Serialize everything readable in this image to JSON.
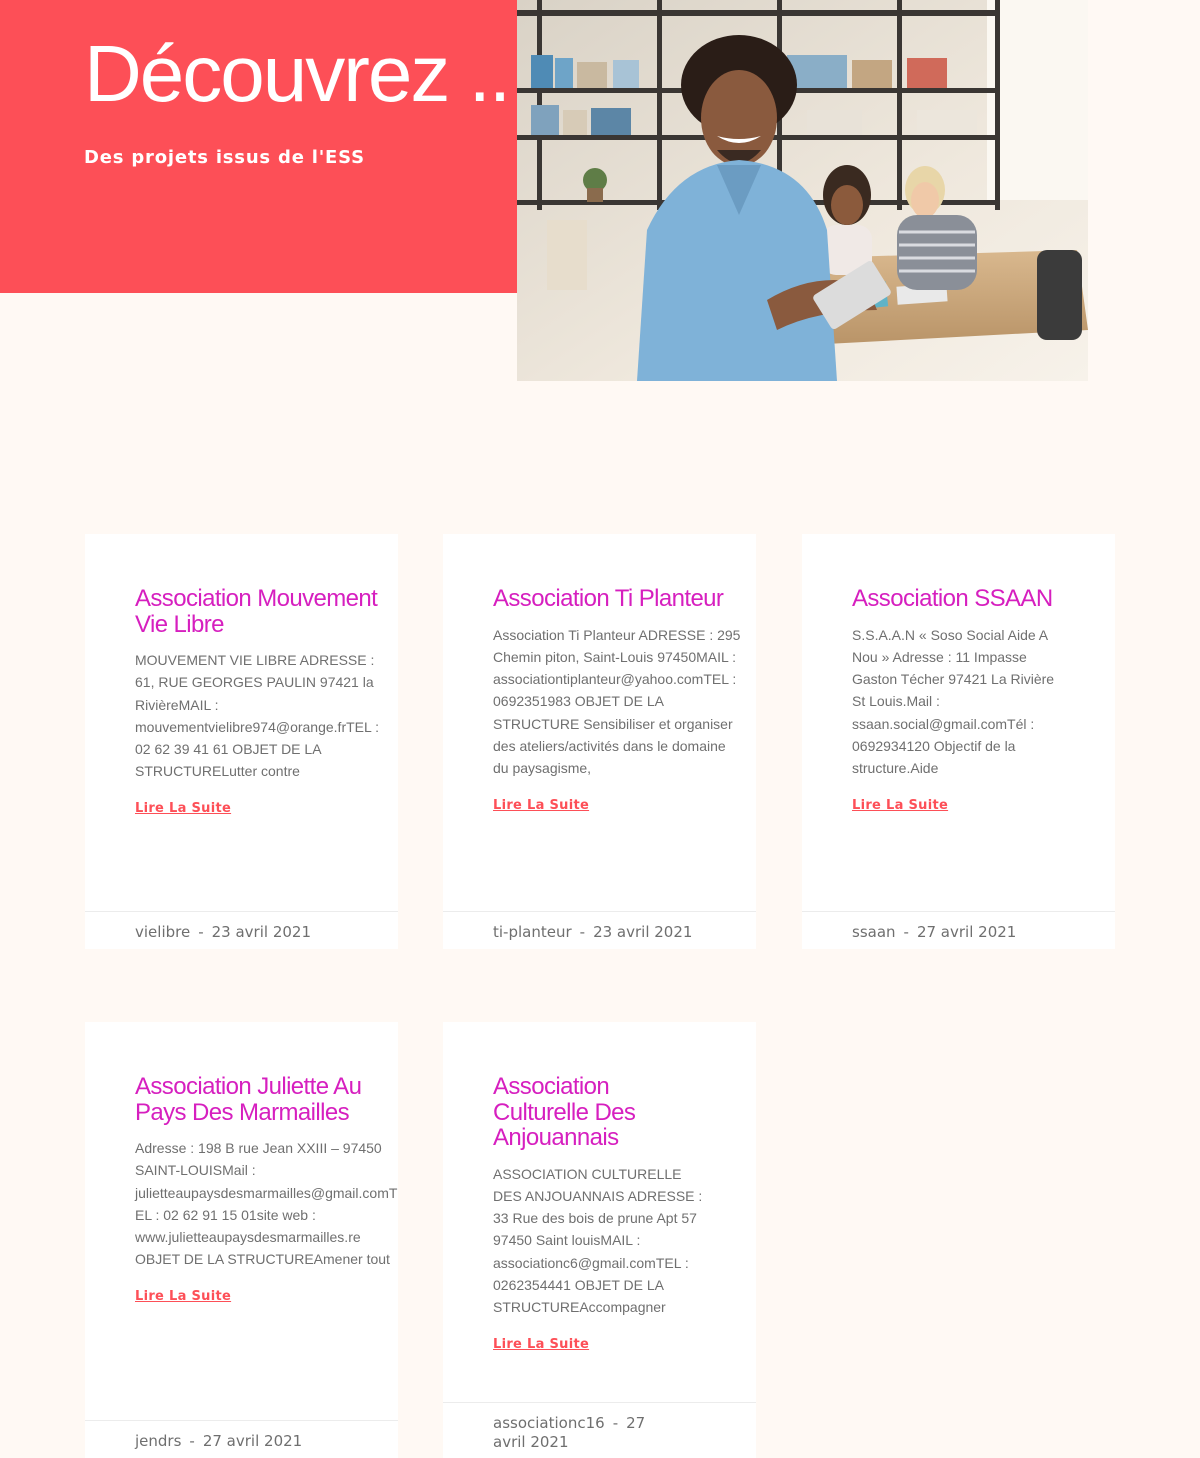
{
  "hero": {
    "title": "Découvrez ..",
    "subtitle": "Des projets issus de l'ESS"
  },
  "colors": {
    "accent": "#fd4f57",
    "title": "#d61fbf",
    "background": "#fff9f4"
  },
  "posts": [
    {
      "title": "Association Mouvement Vie Libre",
      "excerpt": "MOUVEMENT VIE LIBRE ADRESSE : 61, RUE GEORGES PAULIN 97421 la RivièreMAIL : mouvementvielibre974@orange.frTEL : 02 62 39 41 61 OBJET DE LA STRUCTURELutter contre",
      "more": "Lire La Suite",
      "author": "vielibre",
      "sep": "-",
      "date": "23 avril 2021"
    },
    {
      "title": "Association Ti Planteur",
      "excerpt": "Association Ti Planteur ADRESSE : 295 Chemin piton, Saint-Louis 97450MAIL : associationtiplanteur@yahoo.comTEL : 0692351983 OBJET DE LA STRUCTURE Sensibiliser et organiser des ateliers/activités dans le domaine du paysagisme,",
      "more": "Lire La Suite",
      "author": "ti-planteur",
      "sep": "-",
      "date": "23 avril 2021"
    },
    {
      "title": "Association SSAAN",
      "excerpt": "S.S.A.A.N « Soso Social Aide A Nou » Adresse : 11 Impasse Gaston Técher 97421 La Rivière St Louis.Mail : ssaan.social@gmail.comTél : 0692934120 Objectif de la structure.Aide",
      "more": "Lire La Suite",
      "author": "ssaan",
      "sep": "-",
      "date": "27 avril 2021"
    },
    {
      "title": "Association Juliette Au Pays Des Marmailles",
      "excerpt": "Adresse : 198 B rue Jean XXIII – 97450 SAINT-LOUISMail : julietteaupaysdesmarmailles@gmail.comTEL : 02 62 91 15 01site web : www.julietteaupaysdesmarmailles.re OBJET DE LA STRUCTUREAmener tout",
      "more": "Lire La Suite",
      "author": "jendrs",
      "sep": "-",
      "date": "27 avril 2021"
    },
    {
      "title": "Association Culturelle Des Anjouannais",
      "excerpt": "ASSOCIATION CULTURELLE DES ANJOUANNAIS ADRESSE : 33 Rue des bois de prune Apt 57 97450 Saint louisMAIL : associationc6@gmail.comTEL : 0262354441 OBJET DE LA STRUCTUREAccompagner",
      "more": "Lire La Suite",
      "author": "associationc16",
      "sep": "-",
      "date": "27 avril 2021"
    }
  ]
}
